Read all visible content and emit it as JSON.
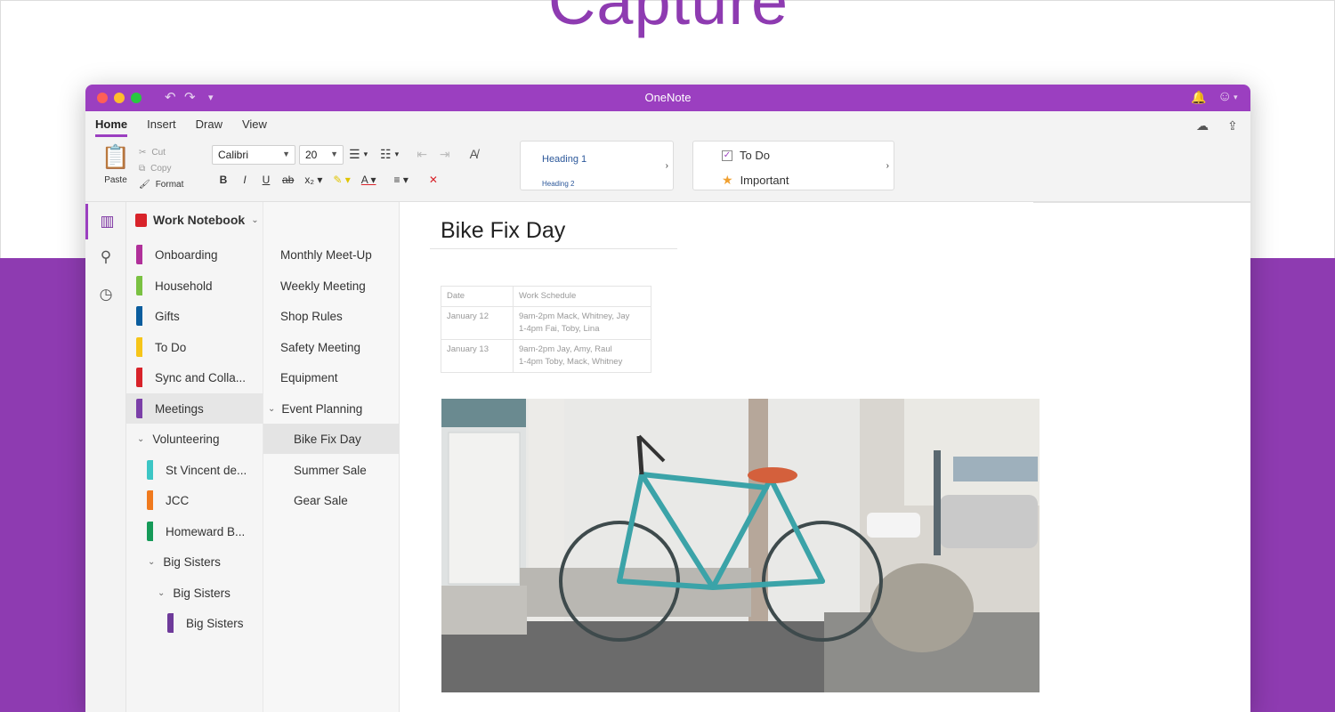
{
  "hero": {
    "title": "Capture"
  },
  "window": {
    "title": "OneNote"
  },
  "ribbon": {
    "tabs": [
      "Home",
      "Insert",
      "Draw",
      "View"
    ],
    "clipboard": {
      "paste": "Paste",
      "cut": "Cut",
      "copy": "Copy",
      "format": "Format"
    },
    "font": {
      "name": "Calibri",
      "size": "20"
    },
    "styles": {
      "heading1": "Heading 1",
      "heading2": "Heading 2"
    },
    "tags": {
      "todo": "To Do",
      "important": "Important"
    }
  },
  "notebook": {
    "name": "Work Notebook"
  },
  "sections": [
    {
      "label": "Onboarding",
      "color": "#b0309a"
    },
    {
      "label": "Household",
      "color": "#7ac142"
    },
    {
      "label": "Gifts",
      "color": "#0b5d9e"
    },
    {
      "label": "To Do",
      "color": "#f6c519"
    },
    {
      "label": "Sync and Colla...",
      "color": "#d8232a"
    },
    {
      "label": "Meetings",
      "color": "#7b3fa8"
    },
    {
      "label": "Volunteering",
      "color": ""
    },
    {
      "label": "St Vincent de...",
      "color": "#3cc6c5"
    },
    {
      "label": "JCC",
      "color": "#f07a1e"
    },
    {
      "label": "Homeward B...",
      "color": "#159a58"
    },
    {
      "label": "Big Sisters",
      "color": ""
    },
    {
      "label": "Big Sisters",
      "color": ""
    },
    {
      "label": "Big Sisters",
      "color": "#6e3a9a"
    }
  ],
  "pages": [
    "Monthly Meet-Up",
    "Weekly Meeting",
    "Shop Rules",
    "Safety Meeting",
    "Equipment",
    "Event Planning",
    "Bike Fix Day",
    "Summer Sale",
    "Gear Sale"
  ],
  "content": {
    "title": "Bike Fix Day",
    "table": {
      "headers": [
        "Date",
        "Work Schedule"
      ],
      "rows": [
        {
          "date": "January 12",
          "line1": "9am-2pm Mack, Whitney, Jay",
          "line2": "1-4pm Fai, Toby, Lina"
        },
        {
          "date": "January 13",
          "line1": "9am-2pm Jay, Amy, Raul",
          "line2": "1-4pm Toby, Mack, Whitney"
        }
      ]
    }
  },
  "colors": {
    "accent": "#9b3fc0",
    "brand_purple": "#8e3bb1"
  }
}
